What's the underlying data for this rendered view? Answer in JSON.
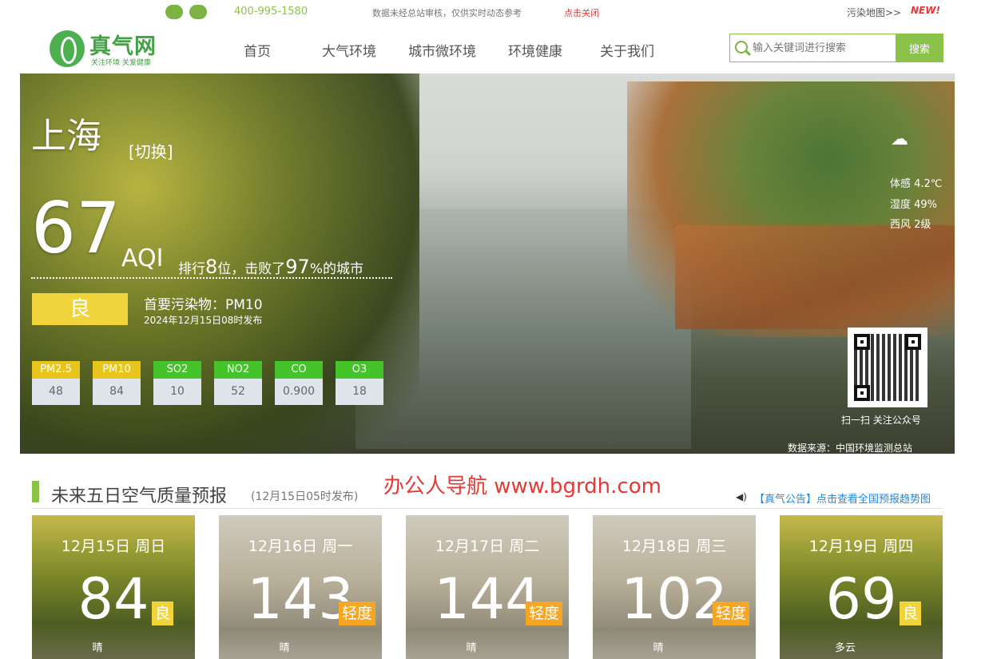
{
  "topbar": {
    "phone": "400-995-1580",
    "notice": "数据未经总站审核，仅供实时动态参考",
    "close_link": "点击关闭",
    "pollution_map": "污染地图>>",
    "new_tag": "NEW!"
  },
  "logo": {
    "text": "真气网",
    "sub": "关注环境 关爱健康"
  },
  "nav": [
    "首页",
    "大气环境",
    "城市微环境",
    "环境健康",
    "关于我们"
  ],
  "search": {
    "placeholder": "输入关键词进行搜索",
    "button": "搜索"
  },
  "hero": {
    "city": "上海",
    "switch": "[切换]",
    "aqi": "67",
    "aqi_label": "AQI",
    "rank_prefix": "排行",
    "rank_value": "8",
    "rank_mid": "位，击败了",
    "beat_value": "97",
    "rank_suffix": "%的城市",
    "level": "良",
    "primary_pollutant": "首要污染物：PM10",
    "published": "2024年12月15日08时发布",
    "pollutants": [
      {
        "name": "PM2.5",
        "value": "48",
        "color": "#e8c51c"
      },
      {
        "name": "PM10",
        "value": "84",
        "color": "#e8c51c"
      },
      {
        "name": "SO2",
        "value": "10",
        "color": "#44c32a"
      },
      {
        "name": "NO2",
        "value": "52",
        "color": "#44c32a"
      },
      {
        "name": "CO",
        "value": "0.900",
        "color": "#44c32a"
      },
      {
        "name": "O3",
        "value": "18",
        "color": "#44c32a"
      }
    ],
    "weather": {
      "feels": "体感 4.2℃",
      "humidity": "湿度 49%",
      "wind": "西风 2级"
    },
    "qr_caption": "扫一扫 关注公众号",
    "source": "数据来源：中国环境监测总站"
  },
  "forecast": {
    "title": "未来五日空气质量预报",
    "subtitle": "(12月15日05时发布)",
    "watermark": "办公人导航 www.bgrdh.com",
    "notice": "【真气公告】点击查看全国预报趋势图",
    "days": [
      {
        "date": "12月15日 周日",
        "aqi": "84",
        "level": "良",
        "weather": "晴",
        "level_color": "#f1d43b"
      },
      {
        "date": "12月16日 周一",
        "aqi": "143",
        "level": "轻度",
        "weather": "晴",
        "level_color": "#f5a623"
      },
      {
        "date": "12月17日 周二",
        "aqi": "144",
        "level": "轻度",
        "weather": "晴",
        "level_color": "#f5a623"
      },
      {
        "date": "12月18日 周三",
        "aqi": "102",
        "level": "轻度",
        "weather": "晴",
        "level_color": "#f5a623"
      },
      {
        "date": "12月19日 周四",
        "aqi": "69",
        "level": "良",
        "weather": "多云",
        "level_color": "#f1d43b"
      }
    ]
  }
}
